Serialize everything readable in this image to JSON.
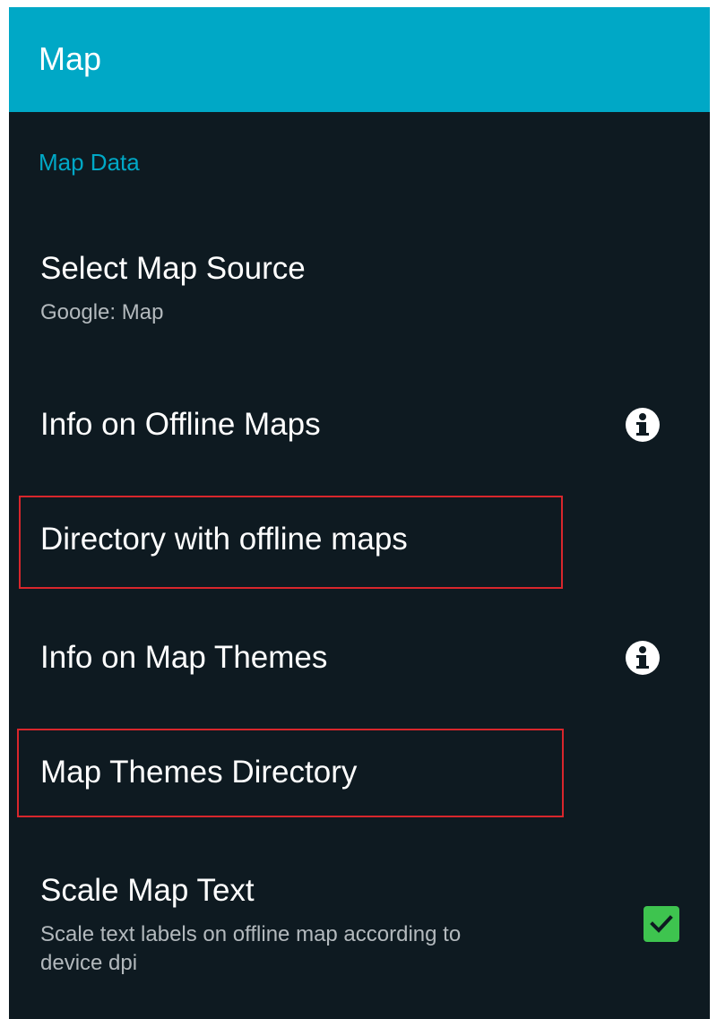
{
  "appbar": {
    "title": "Map"
  },
  "section": {
    "header": "Map Data"
  },
  "prefs": {
    "map_source": {
      "title": "Select Map Source",
      "summary": "Google: Map"
    },
    "offline_maps_info": {
      "title": "Info on Offline Maps",
      "icon": "info-icon"
    },
    "offline_maps_dir": {
      "title": "Directory with offline maps"
    },
    "map_themes_info": {
      "title": "Info on Map Themes",
      "icon": "info-icon"
    },
    "map_themes_dir": {
      "title": "Map Themes Directory"
    },
    "scale_map_text": {
      "title": "Scale Map Text",
      "summary_line1": "Scale text labels on offline map according to",
      "summary_line2": "device dpi",
      "checked": true
    }
  },
  "colors": {
    "appbar": "#00a8c6",
    "background": "#0e1a21",
    "accent": "#00a8c6",
    "highlight": "#d8262c",
    "checkbox": "#3ec44f"
  }
}
